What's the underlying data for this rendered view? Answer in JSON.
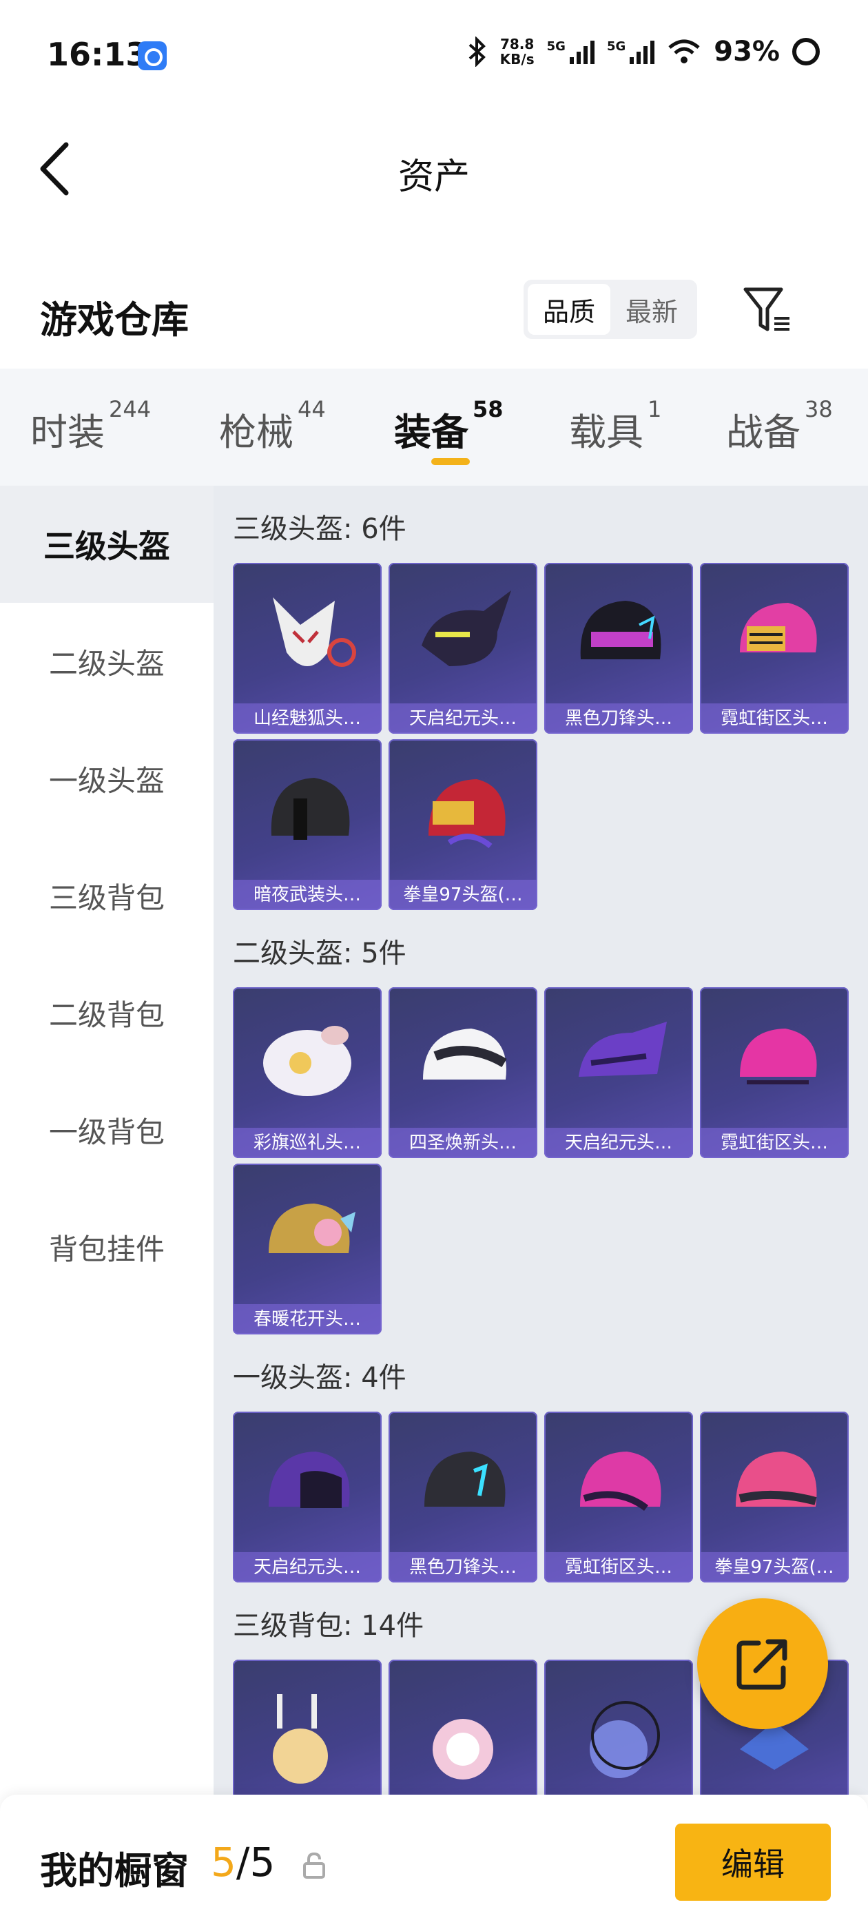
{
  "status_bar": {
    "time": "16:13",
    "net_speed_value": "78.8",
    "net_speed_unit": "KB/s",
    "sig1": "5G",
    "sig2": "5G",
    "battery": "93%"
  },
  "header": {
    "title": "资产"
  },
  "section": {
    "title": "游戏仓库",
    "sort_quality": "品质",
    "sort_latest": "最新"
  },
  "tabs": [
    {
      "label": "时装",
      "count": "244"
    },
    {
      "label": "枪械",
      "count": "44"
    },
    {
      "label": "装备",
      "count": "58"
    },
    {
      "label": "载具",
      "count": "1"
    },
    {
      "label": "战备",
      "count": "38"
    }
  ],
  "sidebar": [
    "三级头盔",
    "二级头盔",
    "一级头盔",
    "三级背包",
    "二级背包",
    "一级背包",
    "背包挂件"
  ],
  "groups": [
    {
      "title": "三级头盔: 6件",
      "items": [
        "山经魅狐头…",
        "天启纪元头…",
        "黑色刀锋头…",
        "霓虹街区头…",
        "暗夜武装头…",
        "拳皇97头盔(…"
      ]
    },
    {
      "title": "二级头盔: 5件",
      "items": [
        "彩旗巡礼头…",
        "四圣焕新头…",
        "天启纪元头…",
        "霓虹街区头…",
        "春暖花开头…"
      ]
    },
    {
      "title": "一级头盔: 4件",
      "items": [
        "天启纪元头…",
        "黑色刀锋头…",
        "霓虹街区头…",
        "拳皇97头盔(…"
      ]
    },
    {
      "title": "三级背包: 14件"
    }
  ],
  "bottom": {
    "label": "我的橱窗",
    "current": "5",
    "separator": "/",
    "total": "5",
    "edit": "编辑"
  }
}
